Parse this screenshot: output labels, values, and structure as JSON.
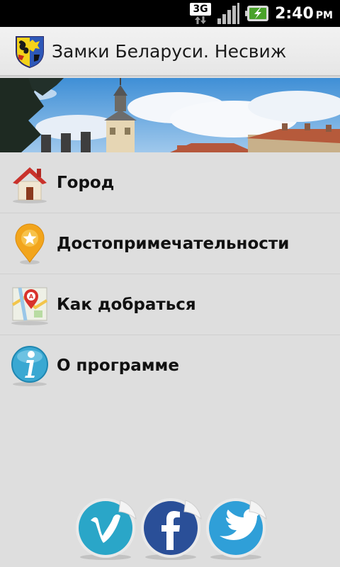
{
  "status_bar": {
    "network": "3G",
    "time": "2:40",
    "ampm": "PM",
    "icons": [
      "3g-data-icon",
      "signal-icon",
      "battery-charging-icon"
    ]
  },
  "header": {
    "title": "Замки Беларуси. Несвиж",
    "logo": "coat-of-arms-icon"
  },
  "menu": {
    "items": [
      {
        "label": "Город",
        "icon": "home-icon"
      },
      {
        "label": "Достопримечательности",
        "icon": "star-pin-icon"
      },
      {
        "label": "Как добраться",
        "icon": "map-icon"
      },
      {
        "label": "О программе",
        "icon": "info-icon"
      }
    ]
  },
  "social": [
    "vimeo-icon",
    "facebook-icon",
    "twitter-icon"
  ],
  "colors": {
    "status_bar": "#000000",
    "background": "#dedede",
    "social_blue_light": "#2aa6c8",
    "social_blue_dark": "#2a4f98"
  }
}
